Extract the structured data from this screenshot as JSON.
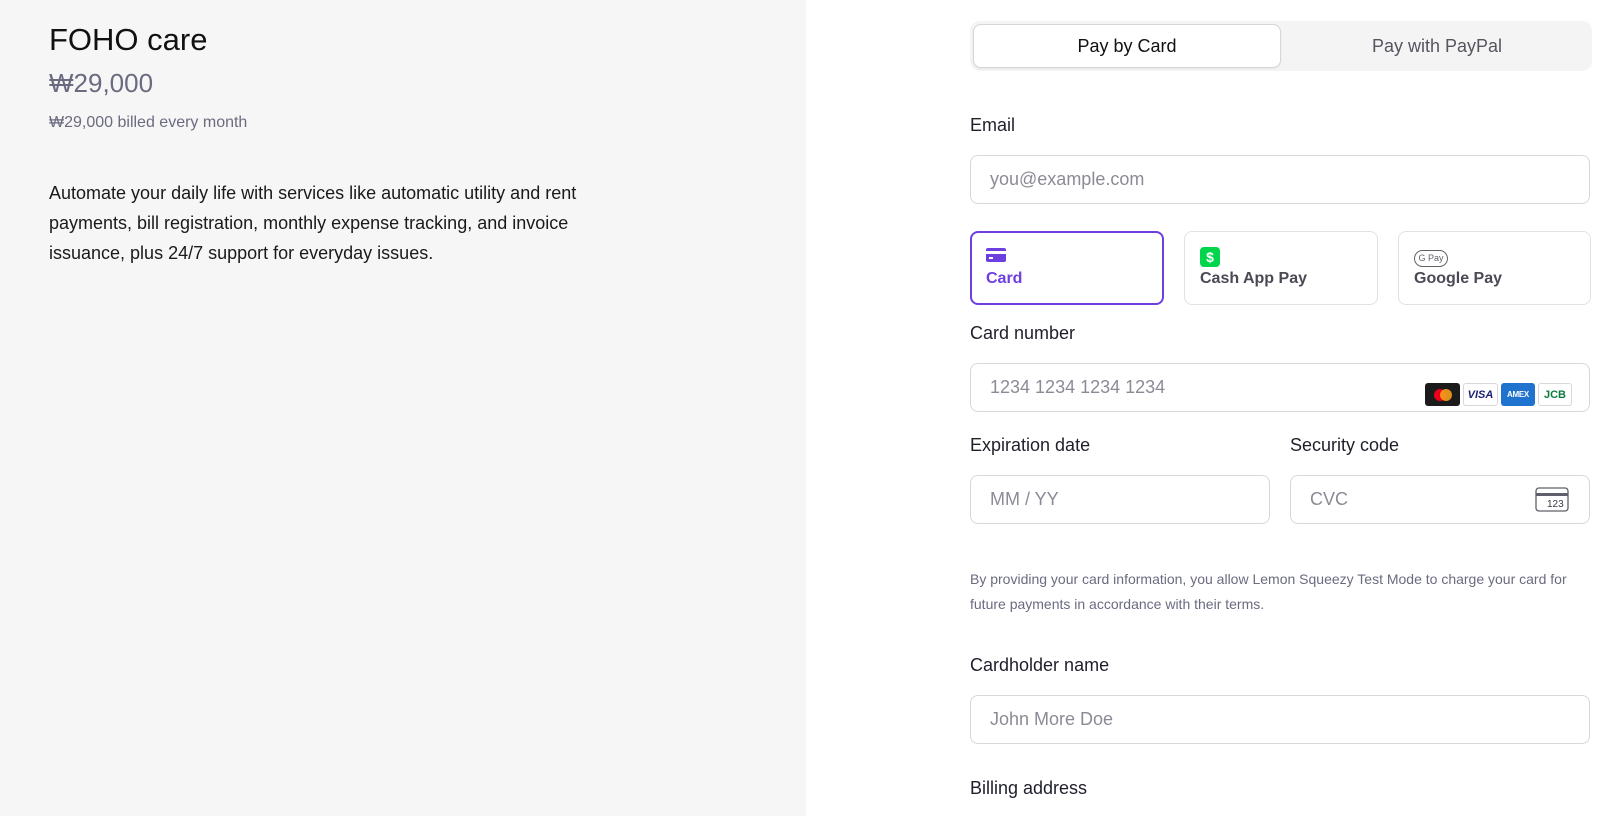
{
  "product": {
    "name": "FOHO care",
    "price": "₩29,000",
    "billing_note": "₩29,000 billed every month",
    "description": "Automate your daily life with services like automatic utility and rent payments, bill registration, monthly expense tracking, and invoice issuance, plus 24/7 support for everyday issues."
  },
  "payment_tabs": {
    "card": "Pay by Card",
    "paypal": "Pay with PayPal"
  },
  "email": {
    "label": "Email",
    "placeholder": "you@example.com"
  },
  "methods": {
    "card": "Card",
    "cashapp": "Cash App Pay",
    "googlepay": "Google Pay",
    "googlepay_badge": "G Pay"
  },
  "card_number": {
    "label": "Card number",
    "placeholder": "1234 1234 1234 1234",
    "brands": {
      "visa": "VISA",
      "amex": "AMEX",
      "jcb": "JCB"
    }
  },
  "expiry": {
    "label": "Expiration date",
    "placeholder": "MM / YY"
  },
  "cvc": {
    "label": "Security code",
    "placeholder": "CVC",
    "icon_text": "123"
  },
  "consent_text": "By providing your card information, you allow Lemon Squeezy Test Mode to charge your card for future payments in accordance with their terms.",
  "cardholder": {
    "label": "Cardholder name",
    "placeholder": "John More Doe"
  },
  "billing_address": {
    "label": "Billing address"
  },
  "colors": {
    "accent": "#6d3ee0",
    "left_panel_bg": "#f6f6f6",
    "cashapp_green": "#00d54b"
  }
}
